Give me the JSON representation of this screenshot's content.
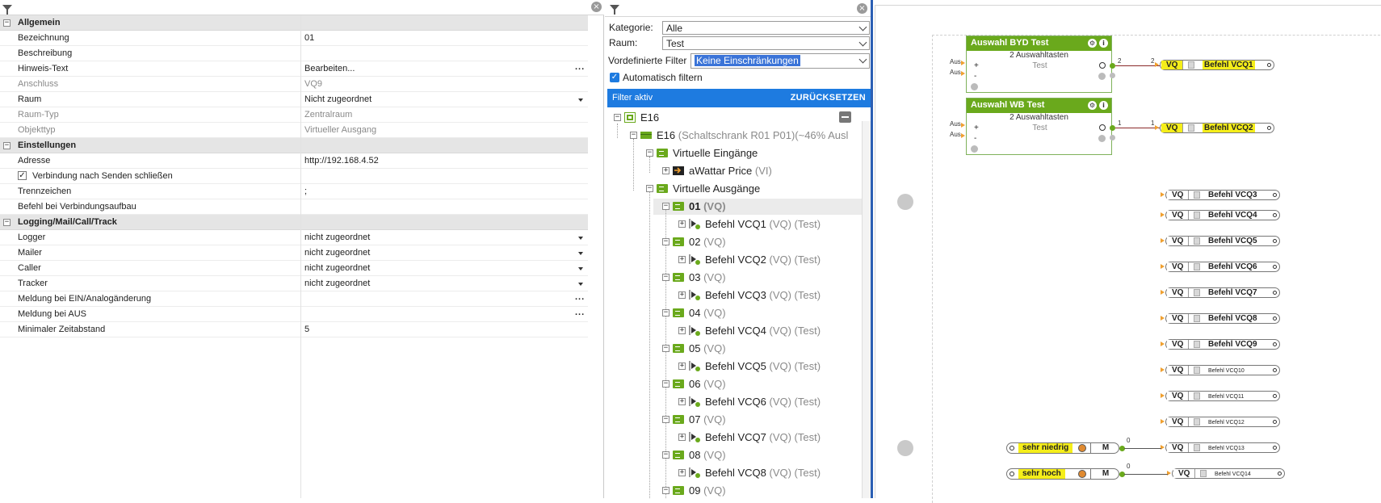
{
  "props": {
    "rows": [
      {
        "type": "section",
        "name": "Allgemein"
      },
      {
        "name": "Bezeichnung",
        "value": "01"
      },
      {
        "name": "Beschreibung",
        "value": ""
      },
      {
        "name": "Hinweis-Text",
        "value": "Bearbeiten...",
        "control": "ellipsis"
      },
      {
        "name": "Anschluss",
        "value": "VQ9",
        "disabled": true
      },
      {
        "name": "Raum",
        "value": "Nicht zugeordnet",
        "control": "dropdown"
      },
      {
        "name": "Raum-Typ",
        "value": "Zentralraum",
        "disabled": true
      },
      {
        "name": "Objekttyp",
        "value": "Virtueller Ausgang",
        "disabled": true
      },
      {
        "type": "section",
        "name": "Einstellungen"
      },
      {
        "name": "Adresse",
        "value": "http://192.168.4.52"
      },
      {
        "name": "Verbindung nach Senden schließen",
        "value": "",
        "checkbox": true
      },
      {
        "name": "Trennzeichen",
        "value": ";"
      },
      {
        "name": "Befehl bei Verbindungsaufbau",
        "value": ""
      },
      {
        "type": "section",
        "name": "Logging/Mail/Call/Track"
      },
      {
        "name": "Logger",
        "value": "nicht zugeordnet",
        "control": "dropdown"
      },
      {
        "name": "Mailer",
        "value": "nicht zugeordnet",
        "control": "dropdown"
      },
      {
        "name": "Caller",
        "value": "nicht zugeordnet",
        "control": "dropdown"
      },
      {
        "name": "Tracker",
        "value": "nicht zugeordnet",
        "control": "dropdown"
      },
      {
        "name": "Meldung bei EIN/Analogänderung",
        "value": "",
        "control": "ellipsis"
      },
      {
        "name": "Meldung bei AUS",
        "value": "",
        "control": "ellipsis"
      },
      {
        "name": "Minimaler Zeitabstand",
        "value": "5"
      }
    ],
    "ellipsis": "...",
    "minus": "−",
    "check": "✓",
    "close": "×"
  },
  "filter": {
    "kategorie_label": "Kategorie:",
    "kategorie_value": "Alle",
    "raum_label": "Raum:",
    "raum_value": "Test",
    "vordef_label": "Vordefinierte Filter",
    "vordef_value": "Keine Einschränkungen",
    "auto_label": "Automatisch filtern",
    "bar_left": "Filter aktiv",
    "bar_right": "ZURÜCKSETZEN"
  },
  "tree": {
    "root": "E16",
    "device": "E16",
    "device_sub": "(Schaltschrank R01 P01)(~46% Ausl",
    "vin": "Virtuelle Eingänge",
    "awattar": "aWattar Price",
    "awattar_sub": "(VI)",
    "vout": "Virtuelle Ausgänge",
    "outputs": [
      {
        "id": "01",
        "sub": "(VQ)",
        "child": "Befehl VCQ1",
        "child_sub": "(VQ) (Test)"
      },
      {
        "id": "02",
        "sub": "(VQ)",
        "child": "Befehl VCQ2",
        "child_sub": "(VQ) (Test)"
      },
      {
        "id": "03",
        "sub": "(VQ)",
        "child": "Befehl VCQ3",
        "child_sub": "(VQ) (Test)"
      },
      {
        "id": "04",
        "sub": "(VQ)",
        "child": "Befehl VCQ4",
        "child_sub": "(VQ) (Test)"
      },
      {
        "id": "05",
        "sub": "(VQ)",
        "child": "Befehl VCQ5",
        "child_sub": "(VQ) (Test)"
      },
      {
        "id": "06",
        "sub": "(VQ)",
        "child": "Befehl VCQ6",
        "child_sub": "(VQ) (Test)"
      },
      {
        "id": "07",
        "sub": "(VQ)",
        "child": "Befehl VCQ7",
        "child_sub": "(VQ) (Test)"
      },
      {
        "id": "08",
        "sub": "(VQ)",
        "child": "Befehl VCQ8",
        "child_sub": "(VQ) (Test)"
      },
      {
        "id": "09",
        "sub": "(VQ)"
      }
    ],
    "plus": "+",
    "minus": "−"
  },
  "canvas": {
    "block1": {
      "title": "Auswahl BYD Test",
      "sub": "2 Auswahltasten",
      "plus": "+",
      "minus": "-",
      "value": "Test",
      "in1": "Aus",
      "in2": "Aus",
      "out": "2",
      "wire_label": "2"
    },
    "block2": {
      "title": "Auswahl WB Test",
      "sub": "2 Auswahltasten",
      "plus": "+",
      "minus": "-",
      "value": "Test",
      "in1": "Aus",
      "in2": "Aus",
      "out": "1",
      "wire_label": "1"
    },
    "vq_tag": "VQ",
    "vq_items": [
      {
        "label": "Befehl VCQ1",
        "highlight": true,
        "small": false
      },
      {
        "label": "Befehl VCQ2",
        "highlight": true,
        "small": false
      },
      {
        "label": "Befehl VCQ3",
        "highlight": false,
        "small": false
      },
      {
        "label": "Befehl VCQ4",
        "highlight": false,
        "small": false
      },
      {
        "label": "Befehl VCQ5",
        "highlight": false,
        "small": false
      },
      {
        "label": "Befehl VCQ6",
        "highlight": false,
        "small": false
      },
      {
        "label": "Befehl VCQ7",
        "highlight": false,
        "small": false
      },
      {
        "label": "Befehl VCQ8",
        "highlight": false,
        "small": false
      },
      {
        "label": "Befehl VCQ9",
        "highlight": false,
        "small": false
      },
      {
        "label": "Befehl VCQ10",
        "highlight": false,
        "small": true
      },
      {
        "label": "Befehl VCQ11",
        "highlight": false,
        "small": true
      },
      {
        "label": "Befehl VCQ12",
        "highlight": false,
        "small": true
      },
      {
        "label": "Befehl VCQ13",
        "highlight": false,
        "small": true
      },
      {
        "label": "Befehl VCQ14",
        "highlight": false,
        "small": true
      }
    ],
    "inputs": [
      {
        "label": "sehr niedrig",
        "mode": "M",
        "out": "0"
      },
      {
        "label": "sehr hoch",
        "mode": "M",
        "out": "0"
      }
    ],
    "info_glyph": "i",
    "gear_glyph": "⚙"
  },
  "colors": {
    "accent": "#1e7be0",
    "green": "#6aa91c",
    "yellow": "#f5ee1a"
  }
}
